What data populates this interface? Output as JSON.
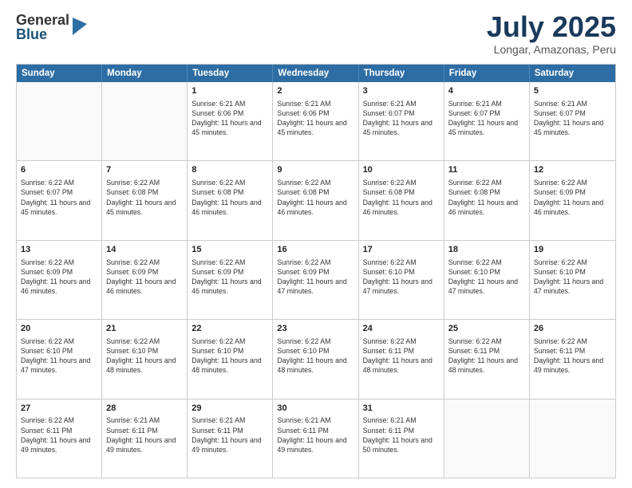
{
  "header": {
    "logo_general": "General",
    "logo_blue": "Blue",
    "month_title": "July 2025",
    "location": "Longar, Amazonas, Peru"
  },
  "weekdays": [
    "Sunday",
    "Monday",
    "Tuesday",
    "Wednesday",
    "Thursday",
    "Friday",
    "Saturday"
  ],
  "rows": [
    [
      {
        "day": "",
        "text": ""
      },
      {
        "day": "",
        "text": ""
      },
      {
        "day": "1",
        "text": "Sunrise: 6:21 AM\nSunset: 6:06 PM\nDaylight: 11 hours and 45 minutes."
      },
      {
        "day": "2",
        "text": "Sunrise: 6:21 AM\nSunset: 6:06 PM\nDaylight: 11 hours and 45 minutes."
      },
      {
        "day": "3",
        "text": "Sunrise: 6:21 AM\nSunset: 6:07 PM\nDaylight: 11 hours and 45 minutes."
      },
      {
        "day": "4",
        "text": "Sunrise: 6:21 AM\nSunset: 6:07 PM\nDaylight: 11 hours and 45 minutes."
      },
      {
        "day": "5",
        "text": "Sunrise: 6:21 AM\nSunset: 6:07 PM\nDaylight: 11 hours and 45 minutes."
      }
    ],
    [
      {
        "day": "6",
        "text": "Sunrise: 6:22 AM\nSunset: 6:07 PM\nDaylight: 11 hours and 45 minutes."
      },
      {
        "day": "7",
        "text": "Sunrise: 6:22 AM\nSunset: 6:08 PM\nDaylight: 11 hours and 45 minutes."
      },
      {
        "day": "8",
        "text": "Sunrise: 6:22 AM\nSunset: 6:08 PM\nDaylight: 11 hours and 46 minutes."
      },
      {
        "day": "9",
        "text": "Sunrise: 6:22 AM\nSunset: 6:08 PM\nDaylight: 11 hours and 46 minutes."
      },
      {
        "day": "10",
        "text": "Sunrise: 6:22 AM\nSunset: 6:08 PM\nDaylight: 11 hours and 46 minutes."
      },
      {
        "day": "11",
        "text": "Sunrise: 6:22 AM\nSunset: 6:08 PM\nDaylight: 11 hours and 46 minutes."
      },
      {
        "day": "12",
        "text": "Sunrise: 6:22 AM\nSunset: 6:09 PM\nDaylight: 11 hours and 46 minutes."
      }
    ],
    [
      {
        "day": "13",
        "text": "Sunrise: 6:22 AM\nSunset: 6:09 PM\nDaylight: 11 hours and 46 minutes."
      },
      {
        "day": "14",
        "text": "Sunrise: 6:22 AM\nSunset: 6:09 PM\nDaylight: 11 hours and 46 minutes."
      },
      {
        "day": "15",
        "text": "Sunrise: 6:22 AM\nSunset: 6:09 PM\nDaylight: 11 hours and 46 minutes."
      },
      {
        "day": "16",
        "text": "Sunrise: 6:22 AM\nSunset: 6:09 PM\nDaylight: 11 hours and 47 minutes."
      },
      {
        "day": "17",
        "text": "Sunrise: 6:22 AM\nSunset: 6:10 PM\nDaylight: 11 hours and 47 minutes."
      },
      {
        "day": "18",
        "text": "Sunrise: 6:22 AM\nSunset: 6:10 PM\nDaylight: 11 hours and 47 minutes."
      },
      {
        "day": "19",
        "text": "Sunrise: 6:22 AM\nSunset: 6:10 PM\nDaylight: 11 hours and 47 minutes."
      }
    ],
    [
      {
        "day": "20",
        "text": "Sunrise: 6:22 AM\nSunset: 6:10 PM\nDaylight: 11 hours and 47 minutes."
      },
      {
        "day": "21",
        "text": "Sunrise: 6:22 AM\nSunset: 6:10 PM\nDaylight: 11 hours and 48 minutes."
      },
      {
        "day": "22",
        "text": "Sunrise: 6:22 AM\nSunset: 6:10 PM\nDaylight: 11 hours and 48 minutes."
      },
      {
        "day": "23",
        "text": "Sunrise: 6:22 AM\nSunset: 6:10 PM\nDaylight: 11 hours and 48 minutes."
      },
      {
        "day": "24",
        "text": "Sunrise: 6:22 AM\nSunset: 6:11 PM\nDaylight: 11 hours and 48 minutes."
      },
      {
        "day": "25",
        "text": "Sunrise: 6:22 AM\nSunset: 6:11 PM\nDaylight: 11 hours and 48 minutes."
      },
      {
        "day": "26",
        "text": "Sunrise: 6:22 AM\nSunset: 6:11 PM\nDaylight: 11 hours and 49 minutes."
      }
    ],
    [
      {
        "day": "27",
        "text": "Sunrise: 6:22 AM\nSunset: 6:11 PM\nDaylight: 11 hours and 49 minutes."
      },
      {
        "day": "28",
        "text": "Sunrise: 6:21 AM\nSunset: 6:11 PM\nDaylight: 11 hours and 49 minutes."
      },
      {
        "day": "29",
        "text": "Sunrise: 6:21 AM\nSunset: 6:11 PM\nDaylight: 11 hours and 49 minutes."
      },
      {
        "day": "30",
        "text": "Sunrise: 6:21 AM\nSunset: 6:11 PM\nDaylight: 11 hours and 49 minutes."
      },
      {
        "day": "31",
        "text": "Sunrise: 6:21 AM\nSunset: 6:11 PM\nDaylight: 11 hours and 50 minutes."
      },
      {
        "day": "",
        "text": ""
      },
      {
        "day": "",
        "text": ""
      }
    ]
  ]
}
